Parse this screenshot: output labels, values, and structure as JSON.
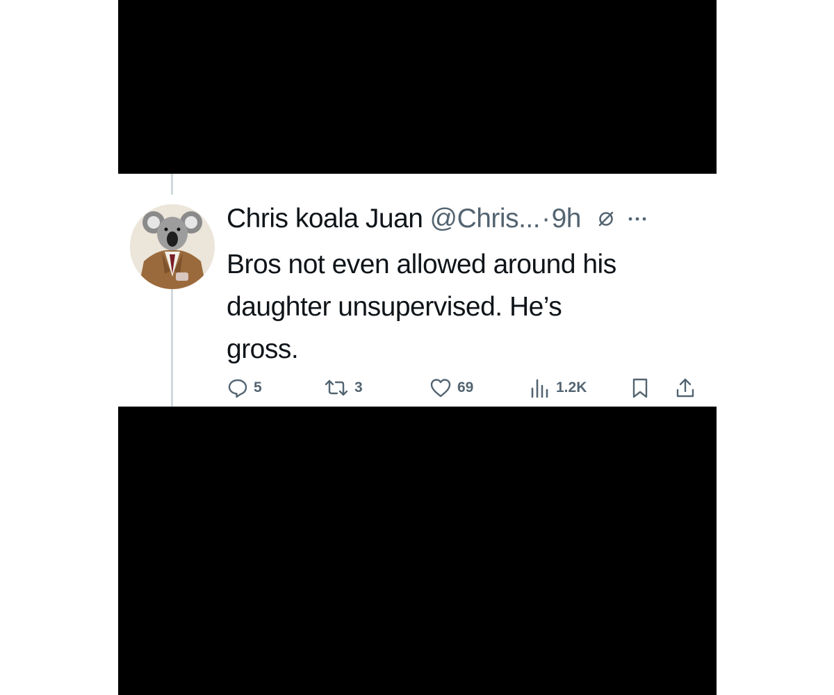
{
  "tweet": {
    "display_name": "Chris koala Juan",
    "handle": "@Chris...",
    "separator": "·",
    "timestamp": "9h",
    "body_lines": [
      "Bros not even allowed around his",
      "daughter unsupervised. He’s",
      "gross."
    ],
    "avatar_icon": "koala-in-suit-avatar",
    "header_icons": [
      "mute-icon",
      "more-icon"
    ]
  },
  "actions": {
    "replies": "5",
    "retweets": "3",
    "likes": "69",
    "views": "1.2K",
    "icons": [
      "reply-icon",
      "retweet-icon",
      "like-icon",
      "views-icon",
      "bookmark-icon",
      "share-icon"
    ]
  },
  "colors": {
    "text_primary": "#0f1419",
    "text_secondary": "#536471",
    "thread_line": "#cfd9de",
    "letterbox": "#000000"
  }
}
